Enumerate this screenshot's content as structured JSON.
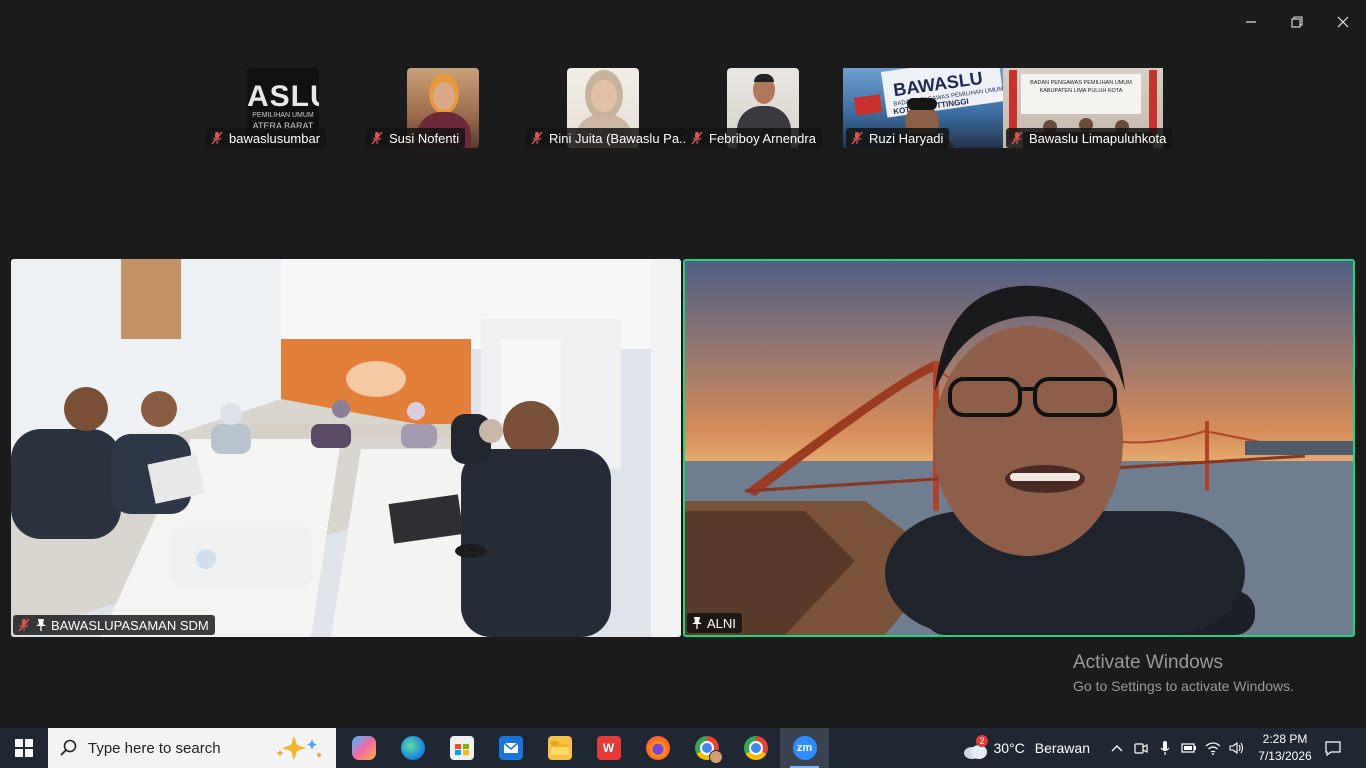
{
  "window": {
    "controls": {
      "minimize": "minimize-icon",
      "restore": "restore-icon",
      "close": "close-icon"
    }
  },
  "participants_strip": [
    {
      "name": "bawaslusumbar",
      "muted": true
    },
    {
      "name": "Susi Nofenti",
      "muted": true
    },
    {
      "name": "Rini Juita (Bawaslu Pa...",
      "muted": true
    },
    {
      "name": "Febriboy Arnendra",
      "muted": true
    },
    {
      "name": "Ruzi Haryadi",
      "muted": true
    },
    {
      "name": "Bawaslu Limapuluhkota",
      "muted": true
    }
  ],
  "thumb_text": {
    "bawaslusumbar_logo": "ASLU",
    "bawaslusumbar_sub1": "PEMILIHAN UMUM",
    "bawaslusumbar_sub2": "ATERA BARAT",
    "ruzi_sign": "BAWASLU",
    "ruzi_sign_sub": "BADAN PENGAWAS PEMILIHAN UMUM",
    "ruzi_sign_city": "KOTA BUKITTINGGI",
    "lpk_banner1": "BADAN PENGAWAS PEMILIHAN UMUM",
    "lpk_banner2": "KABUPATEN LIMA PULUH KOTA"
  },
  "main_tiles": [
    {
      "name": "BAWASLUPASAMAN SDM",
      "muted": true,
      "pinned": true,
      "active_speaker": false
    },
    {
      "name": "ALNI",
      "muted": false,
      "pinned": true,
      "active_speaker": true
    }
  ],
  "watermark": {
    "title": "Activate Windows",
    "subtitle": "Go to Settings to activate Windows."
  },
  "taskbar": {
    "search_placeholder": "Type here to search",
    "apps": [
      {
        "name": "copilot-icon",
        "active": false
      },
      {
        "name": "edge-icon",
        "active": false
      },
      {
        "name": "microsoft-store-icon",
        "active": false
      },
      {
        "name": "outlook-icon",
        "active": false
      },
      {
        "name": "file-explorer-icon",
        "active": false
      },
      {
        "name": "wps-office-icon",
        "label": "W",
        "active": false
      },
      {
        "name": "firefox-icon",
        "active": false
      },
      {
        "name": "chrome-profile-icon",
        "active": false
      },
      {
        "name": "chrome-icon",
        "active": false
      },
      {
        "name": "zoom-icon",
        "label": "zm",
        "active": true
      }
    ],
    "weather": {
      "badge": "2",
      "temp": "30°C",
      "condition": "Berawan"
    },
    "clock": {
      "time": "2:28 PM",
      "date": "7/13/2026"
    }
  },
  "colors": {
    "active_speaker_border": "#22d47b",
    "taskbar": "#1f2733",
    "background": "#1b1b1b"
  }
}
